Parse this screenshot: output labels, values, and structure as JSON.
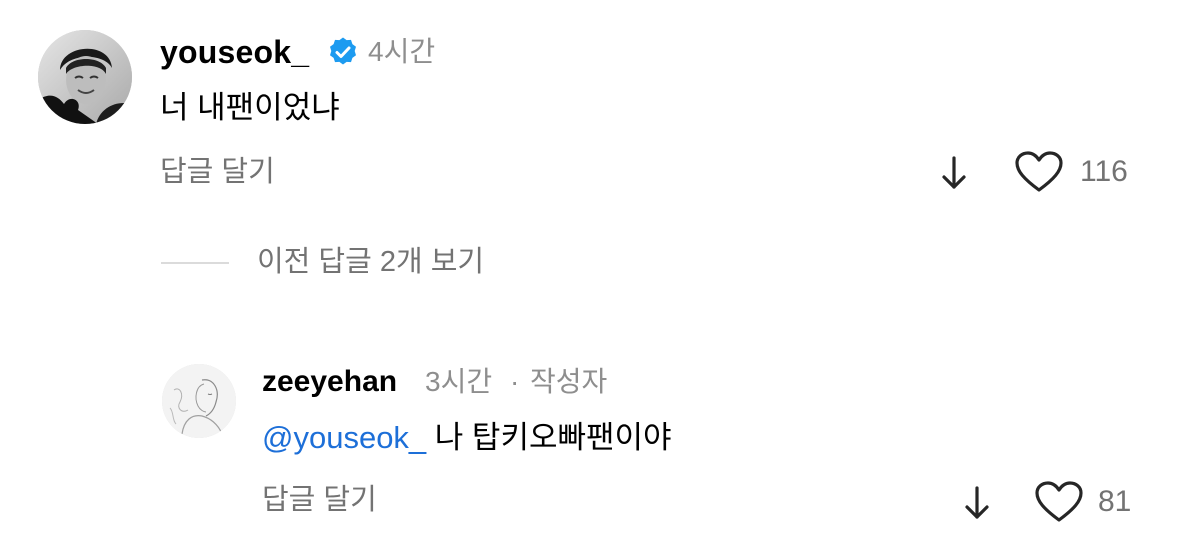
{
  "comment": {
    "username": "youseok_",
    "verified_icon": "verified-badge-icon",
    "time": "4시간",
    "text": "너 내팬이었냐",
    "reply_label": "답글 달기",
    "likes": "116",
    "accent": "#1d9bf0"
  },
  "view_previous": {
    "label": "이전 답글 2개 보기"
  },
  "reply": {
    "username": "zeeyehan",
    "time": "3시간",
    "separator": "·",
    "author_badge": "작성자",
    "mention": "@youseok_",
    "text": " 나 탑키오빠팬이야",
    "reply_label": "답글 달기",
    "likes": "81",
    "mention_color": "#1d6fd8"
  }
}
